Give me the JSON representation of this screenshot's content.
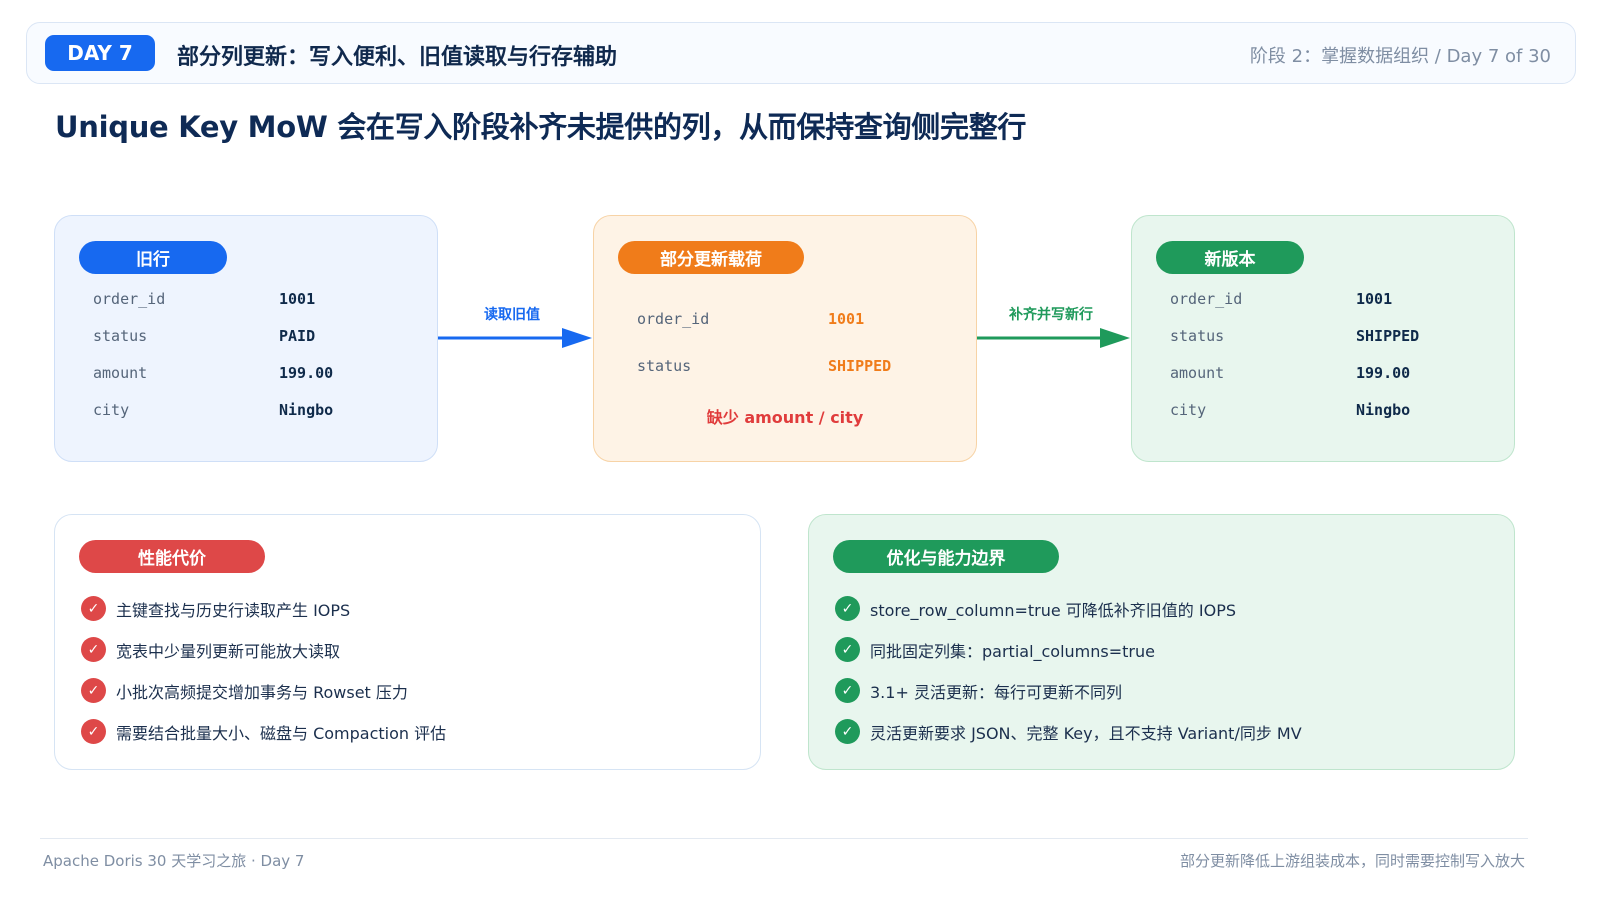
{
  "header": {
    "day_badge": "DAY 7",
    "title": "部分列更新：写入便利、旧值读取与行存辅助",
    "meta": "阶段 2：掌握数据组织 / Day 7 of 30"
  },
  "main_title": "Unique Key MoW 会在写入阶段补齐未提供的列，从而保持查询侧完整行",
  "old_row": {
    "label": "旧行",
    "fields": [
      {
        "key": "order_id",
        "value": "1001"
      },
      {
        "key": "status",
        "value": "PAID"
      },
      {
        "key": "amount",
        "value": "199.00"
      },
      {
        "key": "city",
        "value": "Ningbo"
      }
    ]
  },
  "arrow1": {
    "label": "读取旧值",
    "color": "#1769f0"
  },
  "partial": {
    "label": "部分更新载荷",
    "fields": [
      {
        "key": "order_id",
        "value": "1001"
      },
      {
        "key": "status",
        "value": "SHIPPED"
      }
    ],
    "missing": "缺少 amount / city"
  },
  "arrow2": {
    "label": "补齐并写新行",
    "color": "#1f9a5b"
  },
  "new_row": {
    "label": "新版本",
    "fields": [
      {
        "key": "order_id",
        "value": "1001"
      },
      {
        "key": "status",
        "value": "SHIPPED"
      },
      {
        "key": "amount",
        "value": "199.00"
      },
      {
        "key": "city",
        "value": "Ningbo"
      }
    ]
  },
  "cost": {
    "label": "性能代价",
    "items": [
      "主键查找与历史行读取产生 IOPS",
      "宽表中少量列更新可能放大读取",
      "小批次高频提交增加事务与 Rowset 压力",
      "需要结合批量大小、磁盘与 Compaction 评估"
    ]
  },
  "optimize": {
    "label": "优化与能力边界",
    "items": [
      "store_row_column=true 可降低补齐旧值的 IOPS",
      "同批固定列集：partial_columns=true",
      "3.1+ 灵活更新：每行可更新不同列",
      "灵活更新要求 JSON、完整 Key，且不支持 Variant/同步 MV"
    ]
  },
  "check_glyph": "✓",
  "footer": {
    "left": "Apache Doris 30 天学习之旅 · Day 7",
    "right": "部分更新降低上游组装成本，同时需要控制写入放大"
  }
}
